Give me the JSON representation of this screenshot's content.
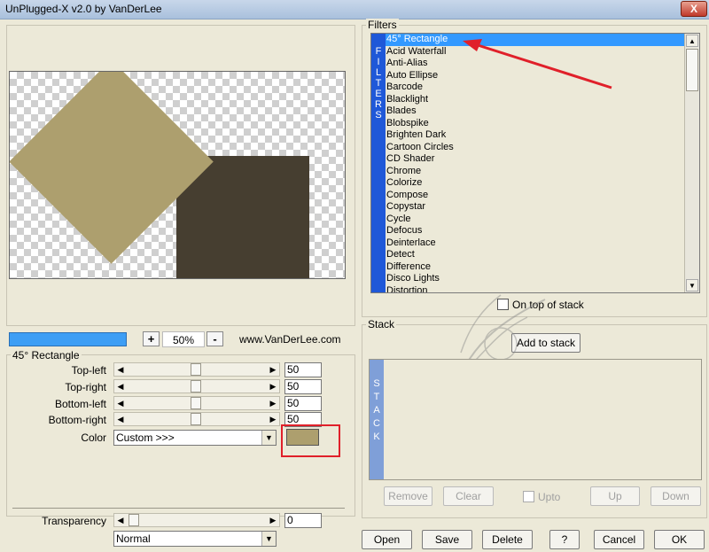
{
  "window": {
    "title": "UnPlugged-X v2.0 by VanDerLee",
    "close_label": "X"
  },
  "zoom": {
    "minus": "-",
    "plus": "+",
    "value": "50%",
    "url": "www.VanDerLee.com"
  },
  "params": {
    "group_title": "45° Rectangle",
    "rows": [
      {
        "label": "Top-left",
        "value": "50"
      },
      {
        "label": "Top-right",
        "value": "50"
      },
      {
        "label": "Bottom-left",
        "value": "50"
      },
      {
        "label": "Bottom-right",
        "value": "50"
      }
    ],
    "color_label": "Color",
    "color_select": "Custom >>>",
    "color_value": "#ad9f6e",
    "transparency_label": "Transparency",
    "transparency_value": "0",
    "blend_mode": "Normal"
  },
  "filters": {
    "group_title": "Filters",
    "side_letters": [
      "F",
      "I",
      "L",
      "T",
      "E",
      "R",
      "S"
    ],
    "items": [
      "45° Rectangle",
      "Acid Waterfall",
      "Anti-Alias",
      "Auto Ellipse",
      "Barcode",
      "Blacklight",
      "Blades",
      "Blobspike",
      "Brighten Dark",
      "Cartoon Circles",
      "CD Shader",
      "Chrome",
      "Colorize",
      "Compose",
      "Copystar",
      "Cycle",
      "Defocus",
      "Deinterlace",
      "Detect",
      "Difference",
      "Disco Lights",
      "Distortion"
    ],
    "selected": "45° Rectangle",
    "on_top_label": "On top of stack"
  },
  "stack": {
    "group_title": "Stack",
    "add_label": "Add to stack",
    "side_letters": [
      "S",
      "T",
      "A",
      "C",
      "K"
    ],
    "remove_label": "Remove",
    "clear_label": "Clear",
    "upto_label": "Upto",
    "up_label": "Up",
    "down_label": "Down"
  },
  "footer": {
    "open": "Open",
    "save": "Save",
    "delete": "Delete",
    "help": "?",
    "cancel": "Cancel",
    "ok": "OK"
  },
  "colors": {
    "accent": "#3399ff",
    "annotation": "#e0202a"
  }
}
